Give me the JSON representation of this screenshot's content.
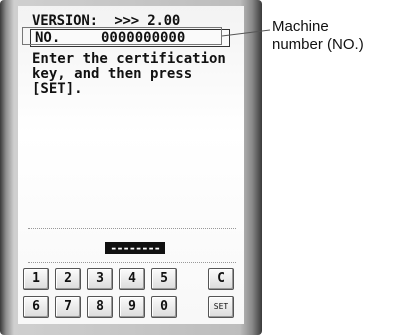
{
  "screen": {
    "version_label": "VERSION:",
    "version_value": ">>> 2.00",
    "no_label": "NO.",
    "no_value": "0000000000",
    "message": "Enter the certification\nkey, and then press\n[SET].",
    "entry_value": "--------"
  },
  "keypad": {
    "row1": [
      "1",
      "2",
      "3",
      "4",
      "5",
      "C"
    ],
    "row2": [
      "6",
      "7",
      "8",
      "9",
      "0",
      "SET"
    ]
  },
  "callout": {
    "line1": "Machine",
    "line2": "number (NO.)"
  }
}
